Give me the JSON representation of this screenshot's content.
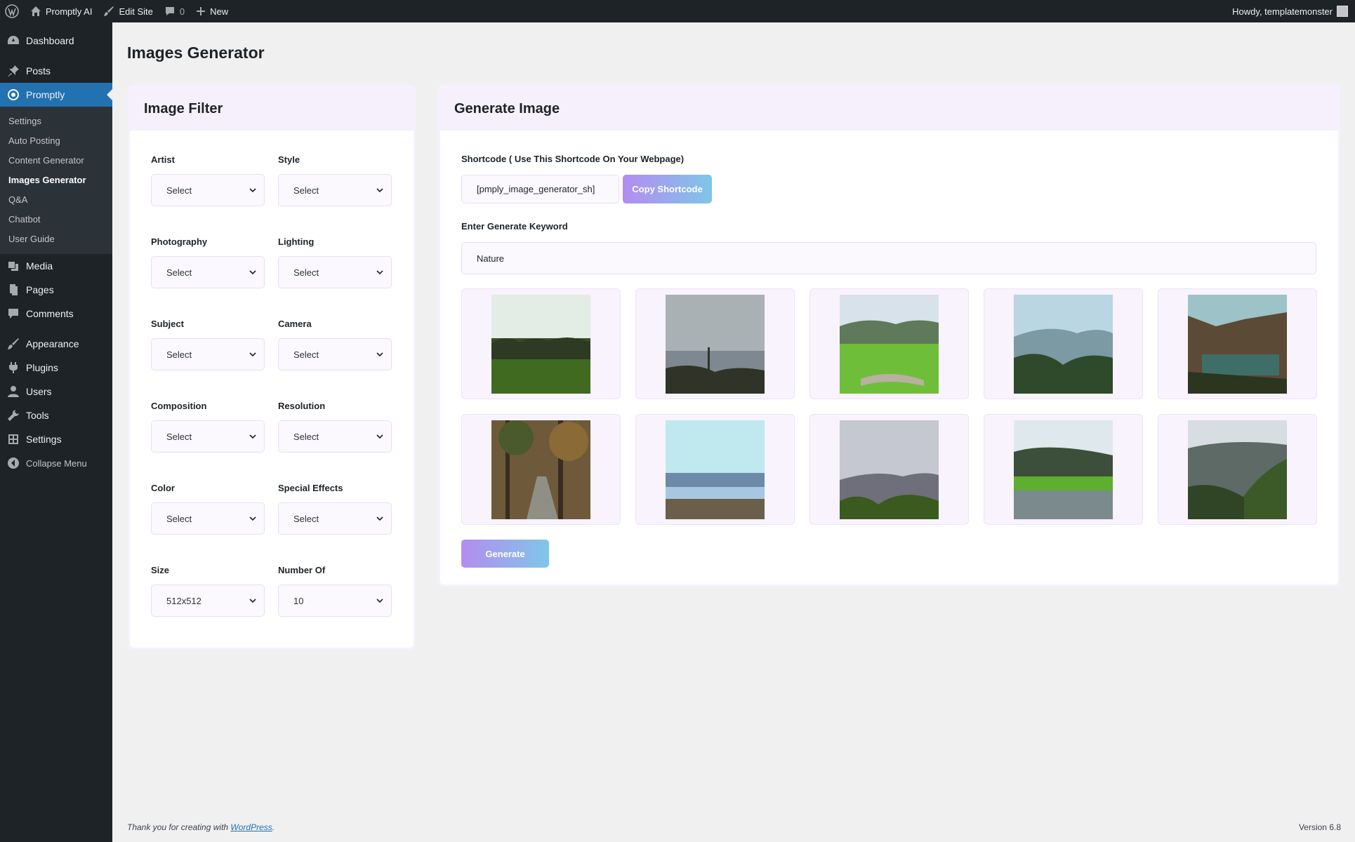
{
  "adminbar": {
    "site_name": "Promptly AI",
    "edit_site": "Edit Site",
    "comments_count": "0",
    "new_label": "New",
    "howdy": "Howdy, templatemonster"
  },
  "sidebar": {
    "dashboard": "Dashboard",
    "posts": "Posts",
    "promptly": "Promptly",
    "submenu": [
      "Settings",
      "Auto Posting",
      "Content Generator",
      "Images Generator",
      "Q&A",
      "Chatbot",
      "User Guide"
    ],
    "media": "Media",
    "pages": "Pages",
    "comments": "Comments",
    "appearance": "Appearance",
    "plugins": "Plugins",
    "users": "Users",
    "tools": "Tools",
    "settings": "Settings",
    "collapse": "Collapse Menu"
  },
  "page_title": "Images Generator",
  "filter": {
    "title": "Image Filter",
    "fields": [
      {
        "label": "Artist",
        "value": "Select"
      },
      {
        "label": "Style",
        "value": "Select"
      },
      {
        "label": "Photography",
        "value": "Select"
      },
      {
        "label": "Lighting",
        "value": "Select"
      },
      {
        "label": "Subject",
        "value": "Select"
      },
      {
        "label": "Camera",
        "value": "Select"
      },
      {
        "label": "Composition",
        "value": "Select"
      },
      {
        "label": "Resolution",
        "value": "Select"
      },
      {
        "label": "Color",
        "value": "Select"
      },
      {
        "label": "Special Effects",
        "value": "Select"
      },
      {
        "label": "Size",
        "value": "512x512"
      },
      {
        "label": "Number Of",
        "value": "10"
      }
    ]
  },
  "generate": {
    "title": "Generate Image",
    "shortcode_label": "Shortcode ( Use This Shortcode On Your Webpage)",
    "shortcode_value": "[pmply_image_generator_sh]",
    "copy_button": "Copy Shortcode",
    "keyword_label": "Enter Generate Keyword",
    "keyword_value": "Nature",
    "generate_button": "Generate",
    "images": [
      {
        "scene": "palm-trees-rice-field"
      },
      {
        "scene": "misty-hills-trees"
      },
      {
        "scene": "green-valley-river"
      },
      {
        "scene": "hazy-mountain-valley"
      },
      {
        "scene": "mountain-lake"
      },
      {
        "scene": "forest-road"
      },
      {
        "scene": "lake-shore-sky"
      },
      {
        "scene": "cloudy-hills-plants"
      },
      {
        "scene": "river-palms-grass"
      },
      {
        "scene": "valley-village"
      }
    ]
  },
  "footer": {
    "thanks": "Thank you for creating with ",
    "wordpress": "WordPress",
    "period": ".",
    "version": "Version 6.8"
  },
  "colors": {
    "admin_dark": "#1d2327",
    "active_blue": "#2271b1",
    "card_header": "#f6f0fc",
    "button_gradient_start": "#b48cf0",
    "button_gradient_end": "#7fc6e8"
  }
}
